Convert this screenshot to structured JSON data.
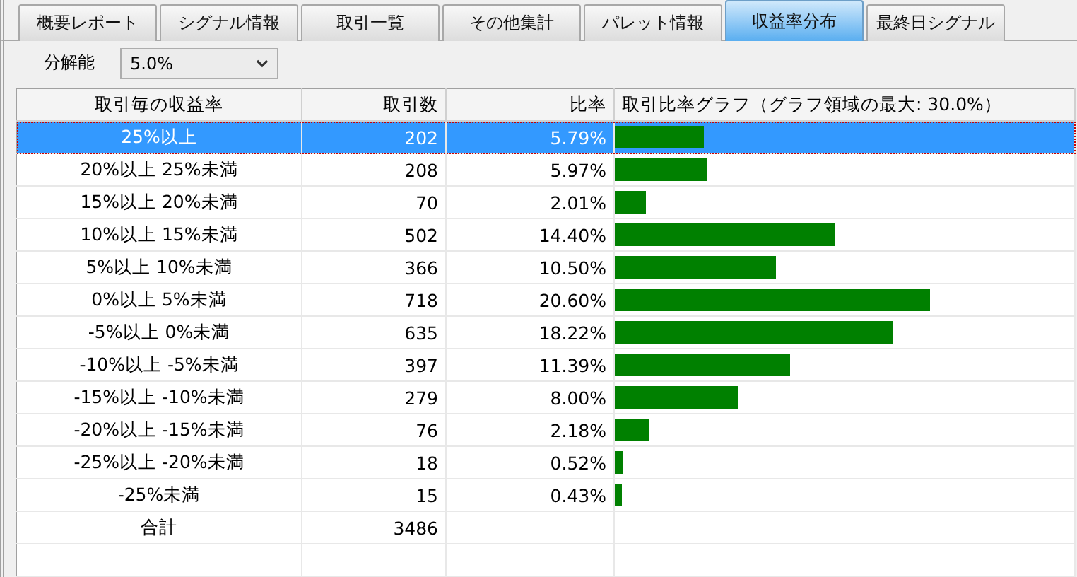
{
  "tabs": [
    {
      "label": "概要レポート",
      "selected": false
    },
    {
      "label": "シグナル情報",
      "selected": false
    },
    {
      "label": "取引一覧",
      "selected": false
    },
    {
      "label": "その他集計",
      "selected": false
    },
    {
      "label": "パレット情報",
      "selected": false
    },
    {
      "label": "収益率分布",
      "selected": true
    },
    {
      "label": "最終日シグナル",
      "selected": false
    }
  ],
  "resolution": {
    "label": "分解能",
    "value": "5.0%"
  },
  "table": {
    "columns": [
      "取引毎の収益率",
      "取引数",
      "比率",
      "取引比率グラフ（グラフ領域の最大: 30.0%）"
    ],
    "rows": [
      {
        "range": "25%以上",
        "count": "202",
        "ratio": "5.79%",
        "level": 0.193,
        "selected": true
      },
      {
        "range": "20%以上 25%未満",
        "count": "208",
        "ratio": "5.97%",
        "level": 0.199,
        "selected": false
      },
      {
        "range": "15%以上 20%未満",
        "count": "70",
        "ratio": "2.01%",
        "level": 0.067,
        "selected": false
      },
      {
        "range": "10%以上 15%未満",
        "count": "502",
        "ratio": "14.40%",
        "level": 0.48,
        "selected": false
      },
      {
        "range": "5%以上 10%未満",
        "count": "366",
        "ratio": "10.50%",
        "level": 0.35,
        "selected": false
      },
      {
        "range": "0%以上 5%未満",
        "count": "718",
        "ratio": "20.60%",
        "level": 0.687,
        "selected": false
      },
      {
        "range": "-5%以上 0%未満",
        "count": "635",
        "ratio": "18.22%",
        "level": 0.607,
        "selected": false
      },
      {
        "range": "-10%以上 -5%未満",
        "count": "397",
        "ratio": "11.39%",
        "level": 0.38,
        "selected": false
      },
      {
        "range": "-15%以上 -10%未満",
        "count": "279",
        "ratio": "8.00%",
        "level": 0.267,
        "selected": false
      },
      {
        "range": "-20%以上 -15%未満",
        "count": "76",
        "ratio": "2.18%",
        "level": 0.073,
        "selected": false
      },
      {
        "range": "-25%以上 -20%未満",
        "count": "18",
        "ratio": "0.52%",
        "level": 0.017,
        "selected": false
      },
      {
        "range": "-25%未満",
        "count": "15",
        "ratio": "0.43%",
        "level": 0.014,
        "selected": false
      }
    ],
    "total": {
      "label": "合計",
      "count": "3486"
    }
  }
}
